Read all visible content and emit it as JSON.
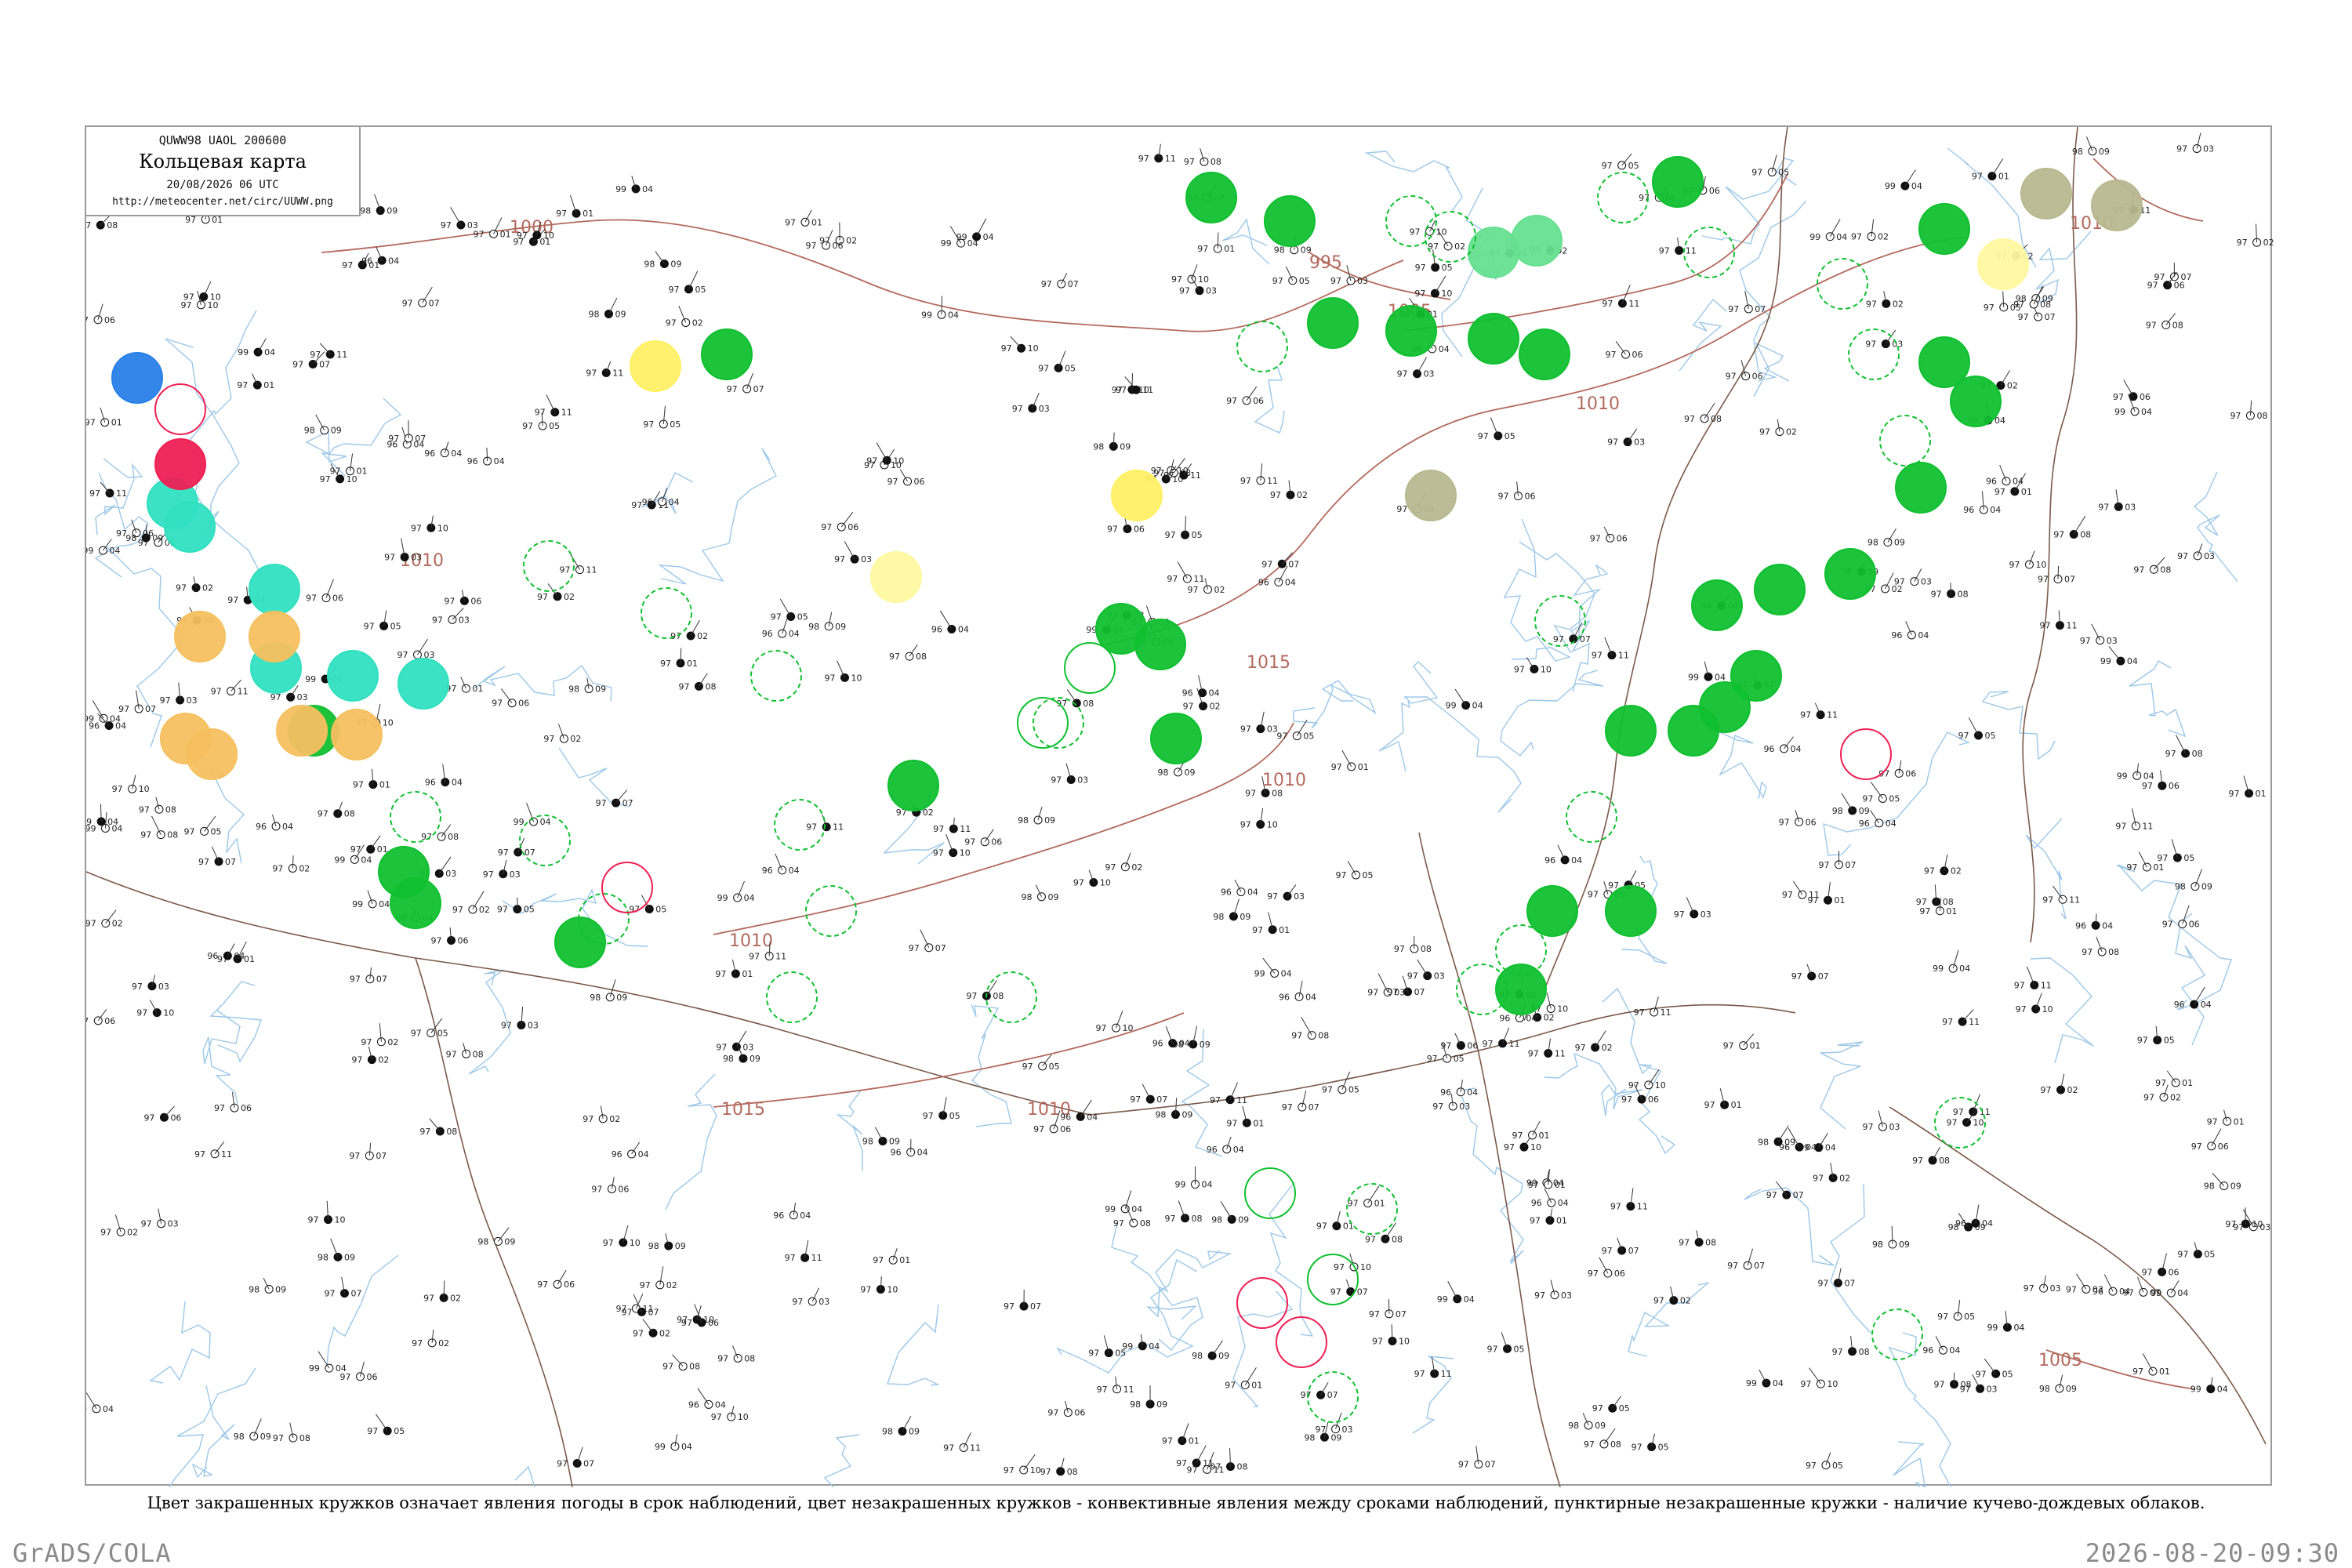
{
  "header": {
    "code": "QUWW98  UAOL  200600",
    "title": "Кольцевая карта",
    "datetime": "20/08/2026 06 UTC",
    "url": "http://meteocenter.net/circ/UUWW.png"
  },
  "caption": "Цвет закрашенных кружков означает явления погоды в срок наблюдений, цвет незакрашенных кружков - конвективные явления между сроками наблюдений, пунктирные незакрашенные кружки - наличие кучево-дождевых облаков.",
  "footer": {
    "left": "GrADS/COLA",
    "right": "2026-08-20-09:30"
  },
  "isobars": [
    "1000",
    "995",
    "1005",
    "1010",
    "1015",
    "1010",
    "1010",
    "1015",
    "1010",
    "1005",
    "1010",
    "1010"
  ],
  "colors": {
    "frame": "#9a9a9a",
    "river": "#9cc8e8",
    "border": "#7a5a4a",
    "isobar": "#b36a5e",
    "rain_shower": "#10c030",
    "thunder_light": "#66e090",
    "fog_mist": "#f5c060",
    "haze": "#fff066",
    "pale_yellow": "#fff8a0",
    "cyan": "#30e0c0",
    "red": "#ee2055",
    "blue": "#2a80e8",
    "olive": "#b8b890"
  },
  "stations": [
    {
      "t": "97",
      "p": "06"
    },
    {
      "t": "99",
      "p": "04"
    },
    {
      "t": "97",
      "p": "08"
    },
    {
      "t": "97",
      "p": "05"
    },
    {
      "t": "97",
      "p": "03"
    },
    {
      "t": "97",
      "p": "01"
    },
    {
      "t": "97",
      "p": "07"
    },
    {
      "t": "97",
      "p": "02"
    },
    {
      "t": "98",
      "p": "09"
    },
    {
      "t": "97",
      "p": "10"
    },
    {
      "t": "96",
      "p": "04"
    },
    {
      "t": "97",
      "p": "11"
    }
  ]
}
